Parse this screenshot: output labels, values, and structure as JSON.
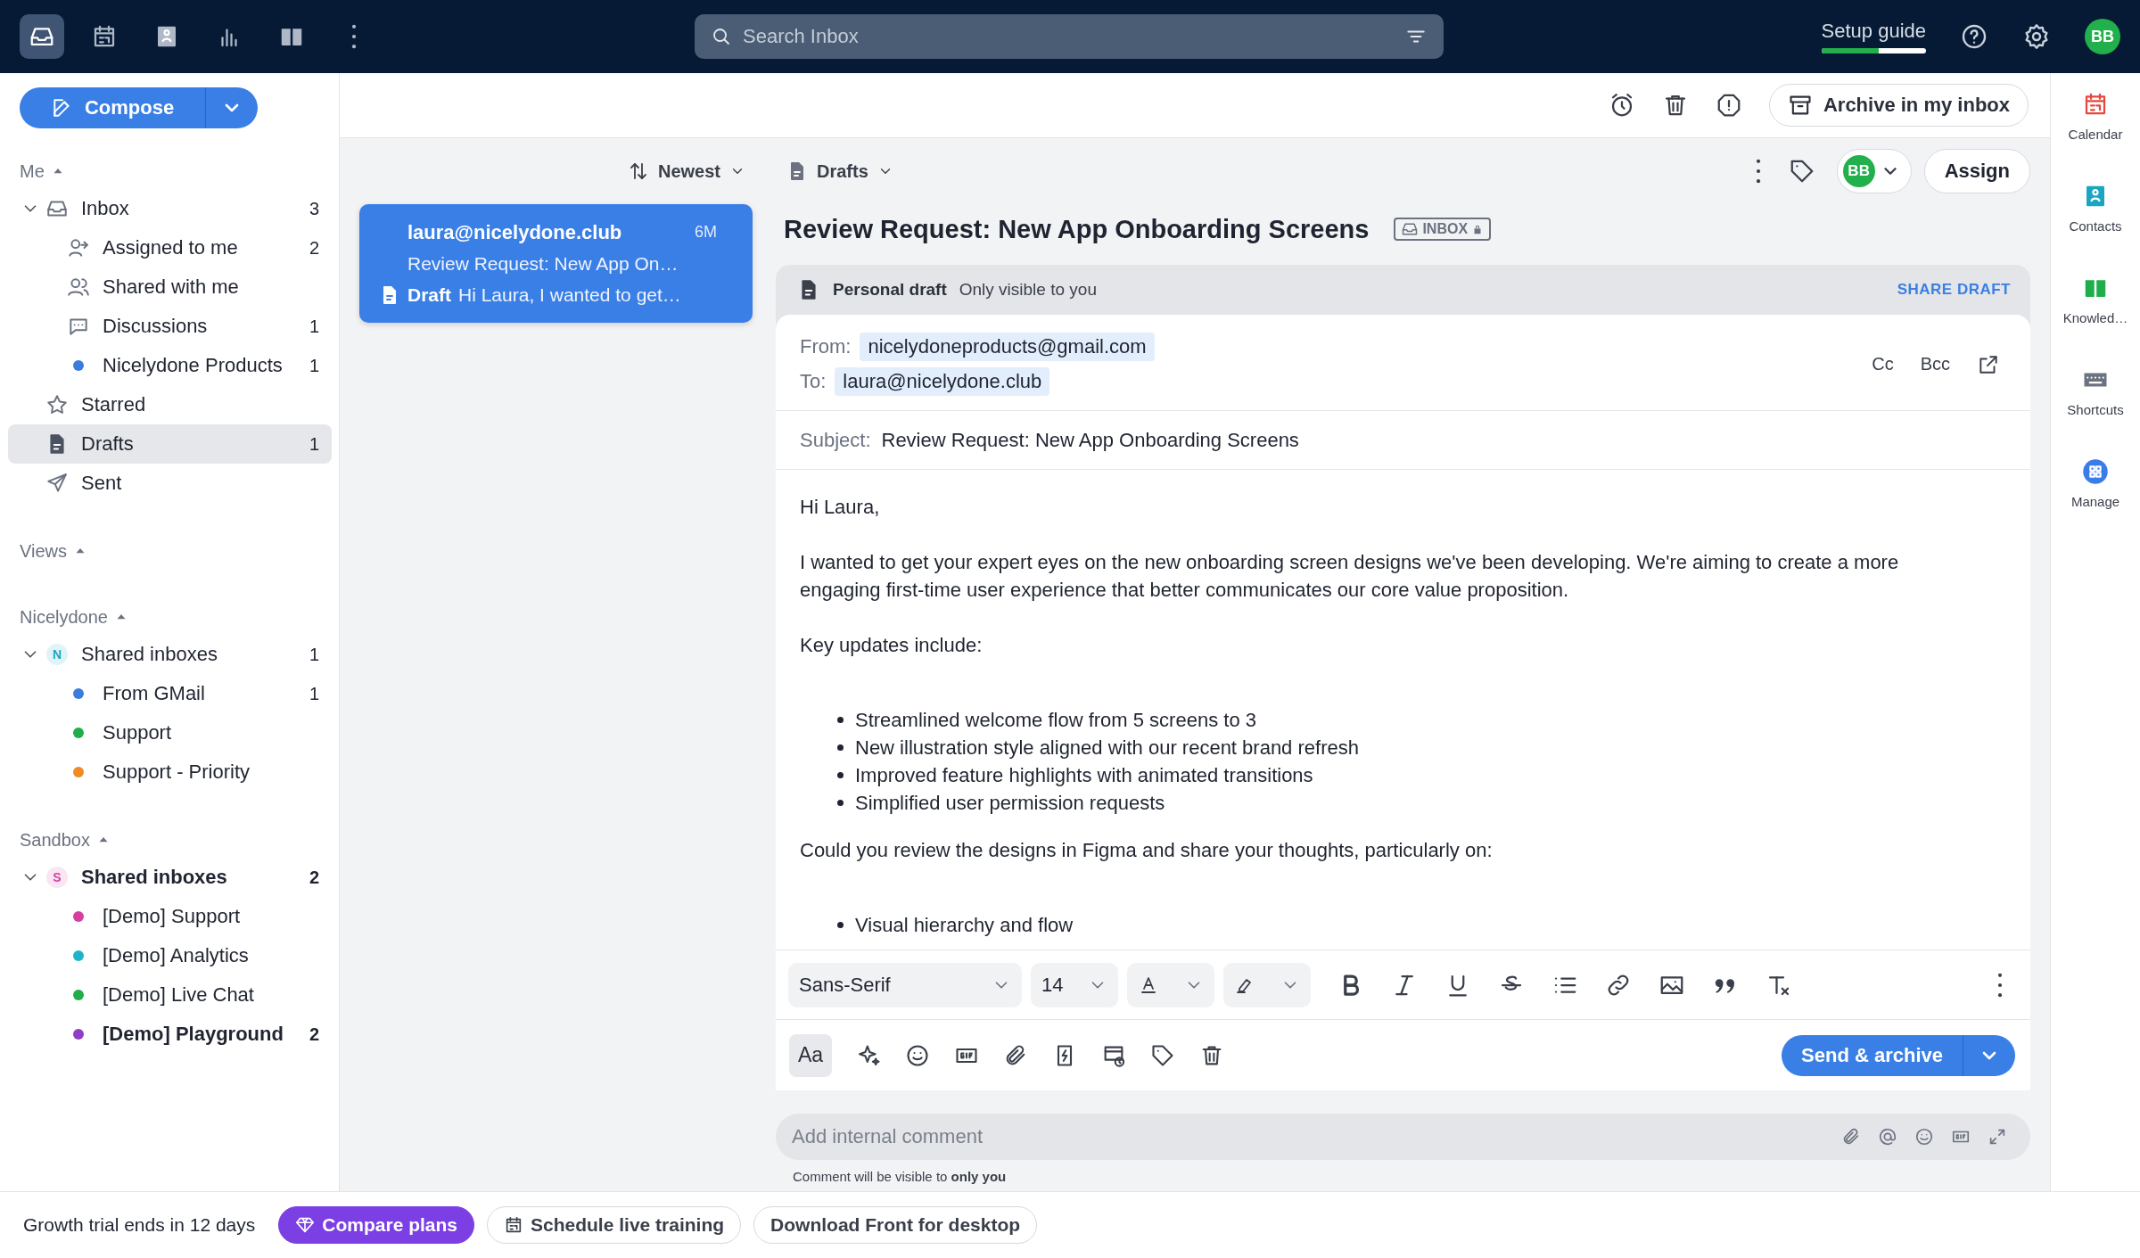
{
  "topbar": {
    "apps": [
      {
        "kind": "inbox",
        "selected": true
      },
      {
        "kind": "calendar",
        "selected": false
      },
      {
        "kind": "contacts",
        "selected": false
      },
      {
        "kind": "analytics",
        "selected": false
      },
      {
        "kind": "knowledge",
        "selected": false
      }
    ],
    "search": {
      "placeholder": "Search Inbox"
    },
    "setup_guide": {
      "label": "Setup guide",
      "level": 0.55
    },
    "avatar": "BB"
  },
  "sidebar": {
    "compose": "Compose",
    "sections": [
      {
        "title": "Me",
        "expanded": true,
        "items": [
          {
            "kind": "inbox",
            "label": "Inbox",
            "count": "3",
            "expanded": true,
            "selected": false,
            "children": [
              {
                "kind": "assigned",
                "label": "Assigned to me",
                "count": "2",
                "selected": false
              },
              {
                "kind": "shared",
                "label": "Shared with me",
                "selected": false
              },
              {
                "kind": "discussions",
                "label": "Discussions",
                "count": "1",
                "selected": false
              },
              {
                "kind": "dot",
                "color": "#3b7ddd",
                "label": "Nicelydone Products",
                "count": "1",
                "selected": false
              }
            ]
          },
          {
            "kind": "star",
            "label": "Starred",
            "selected": false
          },
          {
            "kind": "drafts",
            "label": "Drafts",
            "count": "1",
            "selected": true
          },
          {
            "kind": "sent",
            "label": "Sent",
            "selected": false
          }
        ]
      },
      {
        "title": "Views",
        "expanded": true
      },
      {
        "title": "Nicelydone",
        "expanded": true,
        "items": [
          {
            "kind": "letter",
            "letter": "N",
            "color": "#1aa6c2",
            "label": "Shared inboxes",
            "count": "1",
            "expanded": true,
            "selected": false,
            "children": [
              {
                "kind": "dot",
                "color": "#3b7ddd",
                "label": "From GMail",
                "count": "1",
                "selected": false
              },
              {
                "kind": "dot",
                "color": "#1fae4b",
                "label": "Support",
                "selected": false
              },
              {
                "kind": "dot",
                "color": "#f08a24",
                "label": "Support - Priority",
                "selected": false
              }
            ]
          }
        ]
      },
      {
        "title": "Sandbox",
        "expanded": true,
        "items": [
          {
            "kind": "letter",
            "letter": "S",
            "color": "#d63fa0",
            "label": "Shared inboxes",
            "count": "2",
            "bold": true,
            "expanded": true,
            "selected": false,
            "children": [
              {
                "kind": "dot",
                "color": "#d63fa0",
                "label": "[Demo] Support",
                "selected": false
              },
              {
                "kind": "dot",
                "color": "#1fb3c9",
                "label": "[Demo] Analytics",
                "selected": false
              },
              {
                "kind": "dot",
                "color": "#1fae4b",
                "label": "[Demo] Live Chat",
                "selected": false
              },
              {
                "kind": "dot",
                "color": "#8e3fc4",
                "label": "[Demo] Playground",
                "count": "2",
                "bold": true,
                "selected": false
              }
            ]
          }
        ]
      }
    ]
  },
  "actions": {
    "archive": "Archive in my inbox"
  },
  "list": {
    "sort": "Newest",
    "conversations": [
      {
        "from": "laura@nicelydone.club",
        "time": "6M",
        "subject": "Review Request: New App On…",
        "draft_label": "Draft",
        "preview": "Hi Laura, I wanted to get…",
        "selected": true
      }
    ]
  },
  "conversation": {
    "folder": "Drafts",
    "avatar": "BB",
    "assign": "Assign",
    "title": "Review Request: New App Onboarding Screens",
    "tag": "INBOX",
    "draft": {
      "title": "Personal draft",
      "note": "Only visible to you",
      "share": "SHARE DRAFT",
      "from_label": "From:",
      "from": "nicelydoneproducts@gmail.com",
      "to_label": "To:",
      "to": "laura@nicelydone.club",
      "cc": "Cc",
      "bcc": "Bcc",
      "subject_label": "Subject:",
      "subject": "Review Request: New App Onboarding Screens",
      "body": [
        {
          "kind": "paragraph",
          "text": "Hi Laura,"
        },
        {
          "kind": "paragraph",
          "text": "I wanted to get your expert eyes on the new onboarding screen designs we've been developing. We're aiming to create a more engaging first-time user experience that better communicates our core value proposition."
        },
        {
          "kind": "paragraph",
          "text": "Key updates include:"
        },
        {
          "kind": "bullets",
          "items": [
            "Streamlined welcome flow from 5 screens to 3",
            "New illustration style aligned with our recent brand refresh",
            "Improved feature highlights with animated transitions",
            "Simplified user permission requests"
          ]
        },
        {
          "kind": "paragraph",
          "text": "Could you review the designs in Figma and share your thoughts, particularly on:"
        },
        {
          "kind": "bullets",
          "items": [
            "Visual hierarchy and flow"
          ]
        }
      ],
      "font": "Sans-Serif",
      "size": "14",
      "text_style": {
        "label": "Aa",
        "selected": true
      },
      "send": "Send & archive"
    },
    "comment": {
      "placeholder": "Add internal comment",
      "note": "Comment will be visible to **only you**"
    }
  },
  "rail": [
    {
      "kind": "calendar",
      "label": "Calendar",
      "color": "#e5483f"
    },
    {
      "kind": "contacts",
      "label": "Contacts",
      "color": "#1aa6c2"
    },
    {
      "kind": "knowledge",
      "label": "Knowled…",
      "color": "#1fae4b"
    },
    {
      "kind": "shortcuts",
      "label": "Shortcuts",
      "color": "#6b7280"
    },
    {
      "kind": "manage",
      "label": "Manage",
      "color": "#3b7de8"
    }
  ],
  "bottom": {
    "trial": "Growth trial ends in 12 days",
    "compare": "Compare plans",
    "training": "Schedule live training",
    "download": "Download Front for desktop"
  }
}
